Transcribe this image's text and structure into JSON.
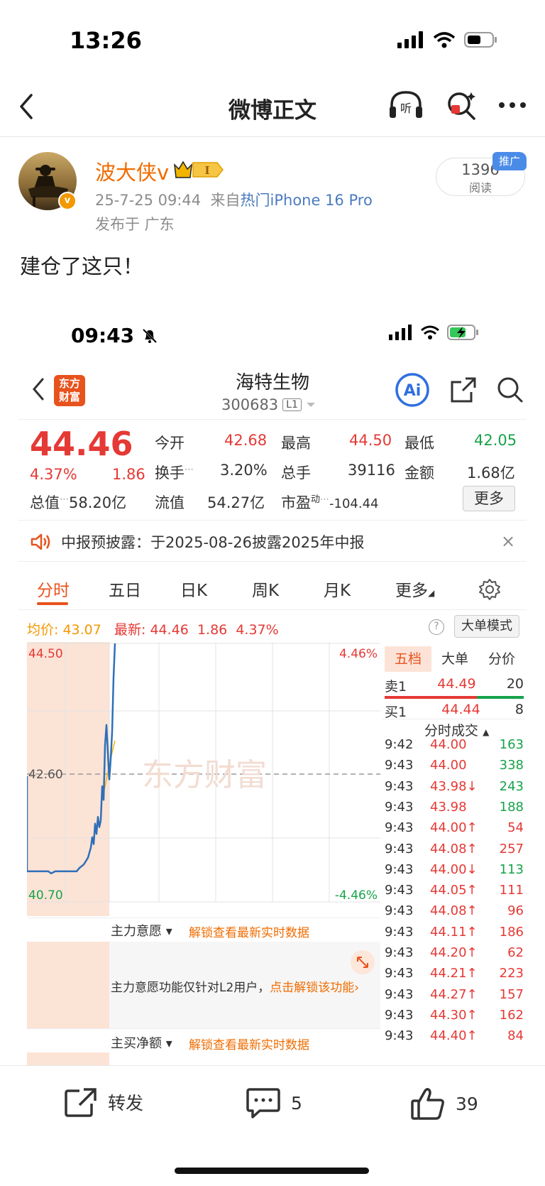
{
  "status_bar": {
    "time": "13:26"
  },
  "nav": {
    "title": "微博正文"
  },
  "post": {
    "username": "波大侠v",
    "vip_level": "I",
    "timestamp": "25-7-25 09:44",
    "source_prefix": "来自",
    "source_link": "热门iPhone 16 Pro",
    "location": "发布于 广东",
    "reads_count": "1396",
    "reads_label": "阅读",
    "promo_badge": "推广",
    "text": "建仓了这只！"
  },
  "embedded": {
    "time": "09:43",
    "stock": {
      "logo_text": "东方财富",
      "name": "海特生物",
      "code": "300683",
      "level": "L1",
      "ai_label": "Ai",
      "price": "44.46",
      "change_pct": "4.37%",
      "change": "1.86",
      "quotes": {
        "open_label": "今开",
        "open": "42.68",
        "high_label": "最高",
        "high": "44.50",
        "low_label": "最低",
        "low": "42.05",
        "turnover_label": "换手",
        "turnover": "3.20%",
        "volume_label": "总手",
        "volume": "39116",
        "amount_label": "金额",
        "amount": "1.68亿",
        "mktcap_label": "总值",
        "mktcap": "58.20亿",
        "float_label": "流值",
        "float": "54.27亿",
        "pe_label": "市盈",
        "pe_sup": "动",
        "pe": "-104.44",
        "more_label": "更多"
      },
      "notice": "中报预披露：于2025-08-26披露2025年中报",
      "tabs": [
        "分时",
        "五日",
        "日K",
        "周K",
        "月K",
        "更多"
      ],
      "avg_label": "均价:",
      "avg_value": "43.07",
      "latest_label": "最新:",
      "latest_price": "44.46",
      "latest_change": "1.86",
      "latest_pct": "4.37%",
      "big_mode": "大单模式",
      "chart": {
        "y_top": "44.50",
        "y_mid": "42.60",
        "y_bot": "40.70",
        "pct_top": "4.46%",
        "pct_bot": "-4.46%",
        "watermark": "东方财富"
      },
      "side_tabs": [
        "五档",
        "大单",
        "分价"
      ],
      "sell1": {
        "label": "卖1",
        "price": "44.49",
        "vol": "20"
      },
      "buy1": {
        "label": "买1",
        "price": "44.44",
        "vol": "8"
      },
      "trades_title": "分时成交",
      "trades": [
        {
          "t": "9:42",
          "p": "44.00",
          "arrow": "",
          "v": "163",
          "c": "green"
        },
        {
          "t": "9:43",
          "p": "44.00",
          "arrow": "",
          "v": "338",
          "c": "green"
        },
        {
          "t": "9:43",
          "p": "43.98",
          "arrow": "↓",
          "v": "243",
          "c": "green"
        },
        {
          "t": "9:43",
          "p": "43.98",
          "arrow": "",
          "v": "188",
          "c": "green"
        },
        {
          "t": "9:43",
          "p": "44.00",
          "arrow": "↑",
          "v": "54",
          "c": "red"
        },
        {
          "t": "9:43",
          "p": "44.08",
          "arrow": "↑",
          "v": "257",
          "c": "red"
        },
        {
          "t": "9:43",
          "p": "44.00",
          "arrow": "↓",
          "v": "113",
          "c": "green"
        },
        {
          "t": "9:43",
          "p": "44.05",
          "arrow": "↑",
          "v": "111",
          "c": "red"
        },
        {
          "t": "9:43",
          "p": "44.08",
          "arrow": "↑",
          "v": "96",
          "c": "red"
        },
        {
          "t": "9:43",
          "p": "44.11",
          "arrow": "↑",
          "v": "186",
          "c": "red"
        },
        {
          "t": "9:43",
          "p": "44.20",
          "arrow": "↑",
          "v": "62",
          "c": "red"
        },
        {
          "t": "9:43",
          "p": "44.21",
          "arrow": "↑",
          "v": "223",
          "c": "red"
        },
        {
          "t": "9:43",
          "p": "44.27",
          "arrow": "↑",
          "v": "157",
          "c": "red"
        },
        {
          "t": "9:43",
          "p": "44.30",
          "arrow": "↑",
          "v": "162",
          "c": "red"
        },
        {
          "t": "9:43",
          "p": "44.40",
          "arrow": "↑",
          "v": "84",
          "c": "red"
        }
      ],
      "l2": {
        "main_intent": "主力意愿",
        "unlock_link": "解锁查看最新实时数据",
        "l2_only_text": "主力意愿功能仅针对L2用户，",
        "l2_only_link": "点击解锁该功能",
        "net_buy": "主买净额"
      }
    }
  },
  "actions": {
    "repost": "转发",
    "comments": "5",
    "likes": "39"
  },
  "colors": {
    "up": "#e53935",
    "down": "#16a34a",
    "accent": "#e8521c",
    "link": "#4b7bc0",
    "username": "#f06c00"
  }
}
